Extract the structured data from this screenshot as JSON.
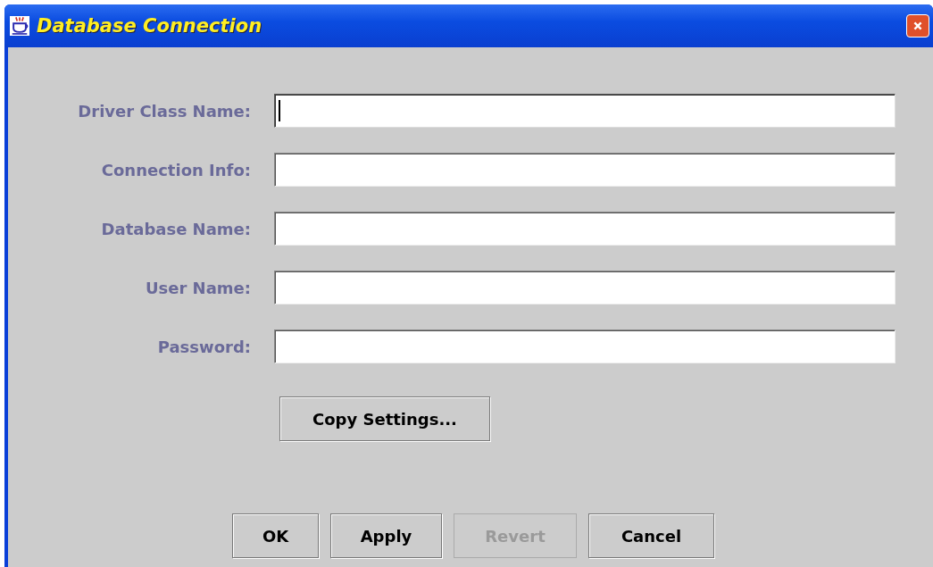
{
  "window": {
    "title": "Database Connection"
  },
  "fields": [
    {
      "label": "Driver Class Name:",
      "focused": true
    },
    {
      "label": "Connection Info:",
      "focused": false
    },
    {
      "label": "Database Name:",
      "focused": false
    },
    {
      "label": "User Name:",
      "focused": false
    },
    {
      "label": "Password:",
      "focused": false
    }
  ],
  "copy_button": {
    "label": "Copy Settings...",
    "disabled": false
  },
  "buttons": [
    {
      "label": "OK",
      "disabled": false
    },
    {
      "label": "Apply",
      "disabled": false
    },
    {
      "label": "Revert",
      "disabled": true
    },
    {
      "label": "Cancel",
      "disabled": false
    }
  ]
}
